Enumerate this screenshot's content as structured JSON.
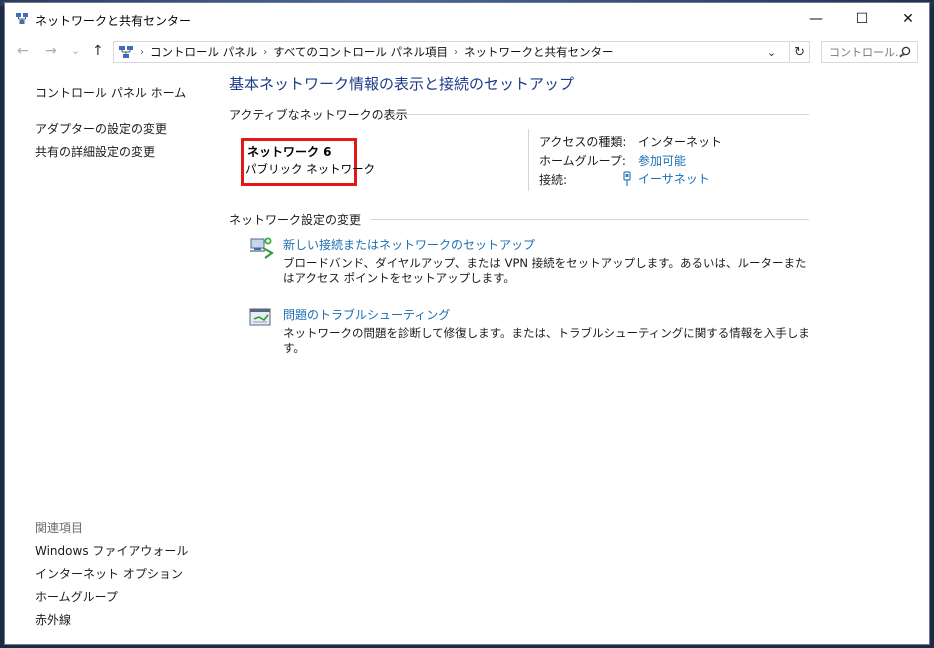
{
  "window": {
    "title": "ネットワークと共有センター",
    "controls": {
      "minimize": "—",
      "maximize": "☐",
      "close": "✕"
    }
  },
  "nav": {
    "back": "←",
    "forward": "→",
    "dropdown": "⌄",
    "up": "↑",
    "breadcrumb": [
      "コントロール パネル",
      "すべてのコントロール パネル項目",
      "ネットワークと共有センター"
    ],
    "addr_dropdown": "⌄",
    "refresh": "↻",
    "search_placeholder": "コントロール..."
  },
  "sidebar": {
    "home": "コントロール パネル ホーム",
    "items": [
      "アダプターの設定の変更",
      "共有の詳細設定の変更"
    ],
    "related_title": "関連項目",
    "related": [
      "Windows ファイアウォール",
      "インターネット オプション",
      "ホームグループ",
      "赤外線"
    ]
  },
  "main": {
    "heading": "基本ネットワーク情報の表示と接続のセットアップ",
    "active_title": "アクティブなネットワークの表示",
    "network_name": "ネットワーク 6",
    "network_type": "パブリック ネットワーク",
    "access_type_label": "アクセスの種類:",
    "access_type_value": "インターネット",
    "homegroup_label": "ホームグループ:",
    "homegroup_value": "参加可能",
    "connection_label": "接続:",
    "connection_value": "イーサネット",
    "change_title": "ネットワーク設定の変更",
    "tasks": [
      {
        "title": "新しい接続またはネットワークのセットアップ",
        "desc": "ブロードバンド、ダイヤルアップ、または VPN 接続をセットアップします。あるいは、ルーターまたはアクセス ポイントをセットアップします。"
      },
      {
        "title": "問題のトラブルシューティング",
        "desc": "ネットワークの問題を診断して修復します。または、トラブルシューティングに関する情報を入手します。"
      }
    ]
  },
  "colors": {
    "accent": "#1e3b8a",
    "link": "#1a6fb3",
    "highlight_box": "#e1191b"
  }
}
